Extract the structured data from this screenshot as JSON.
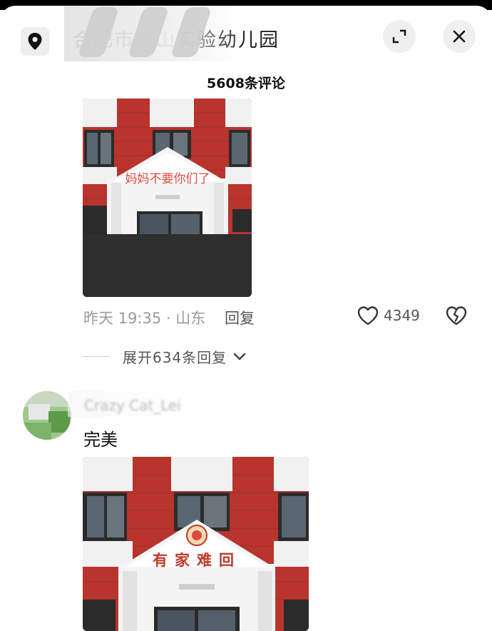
{
  "header": {
    "location_title": "合肥市某山实验幼儿园",
    "location_icon": "map-pin-icon",
    "expand_icon": "fullscreen-icon",
    "close_icon": "close-icon"
  },
  "comments_count_label": "5608条评论",
  "comment1": {
    "image_caption": "妈妈不要你们了",
    "time_location": "昨天 19:35 · 山东",
    "reply_label": "回复",
    "likes": "4349",
    "expand_replies": "展开634条回复"
  },
  "comment2": {
    "username": "Crazy Cat_Lei",
    "text": "完美",
    "image_caption": "有家难回"
  },
  "colors": {
    "brick": "#b8342d",
    "sign_red": "#e0483f",
    "muted_text": "#9a9a9a"
  }
}
